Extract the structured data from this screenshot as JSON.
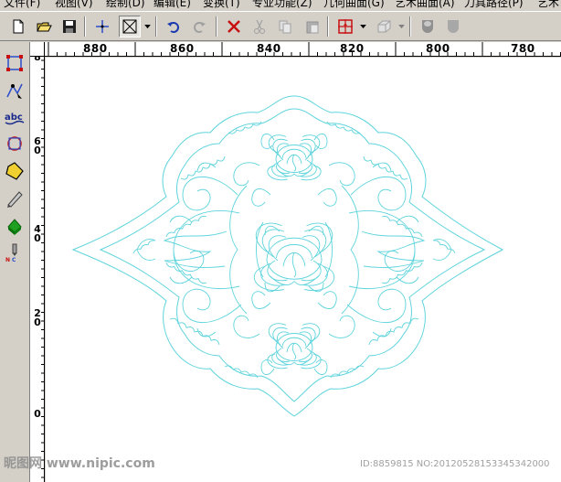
{
  "menubar": {
    "items": [
      "文件(F)",
      "视图(V)",
      "绘制(D)",
      "编辑(E)",
      "变换(T)",
      "专业功能(Z)",
      "几何曲面(G)",
      "艺术曲面(A)",
      "刀具路径(P)",
      "艺术"
    ]
  },
  "toolbar": {
    "buttons": [
      "new-file-icon",
      "open-folder-icon",
      "save-icon",
      "node-edit-icon",
      "rectangle-select-icon",
      "undo-icon",
      "redo-icon",
      "delete-icon",
      "cut-icon",
      "copy-icon",
      "paste-icon",
      "snap-icon",
      "3d-view-icon",
      "shaded-relief-icon",
      "shield-relief-icon"
    ],
    "pressed": "rectangle-select-icon"
  },
  "palette": {
    "tools": [
      "select-rect-icon",
      "node-edit-tool-icon",
      "text-tool-icon",
      "transform-tool-icon",
      "polygon-tool-icon",
      "sculpt-tool-icon",
      "relief-tool-icon",
      "nc-tool-icon"
    ]
  },
  "ruler_h": {
    "labels": [
      "880",
      "860",
      "840",
      "820",
      "800",
      "780"
    ]
  },
  "ruler_v": {
    "labels": [
      "8",
      "6\n0",
      "4\n0",
      "2\n0",
      "0"
    ]
  },
  "canvas": {
    "stroke_color": "#5fd4dc",
    "background": "#ffffff"
  },
  "watermark": {
    "left": "昵图网 www.nipic.com",
    "right": "ID:8859815 NO:20120528153345342000"
  }
}
